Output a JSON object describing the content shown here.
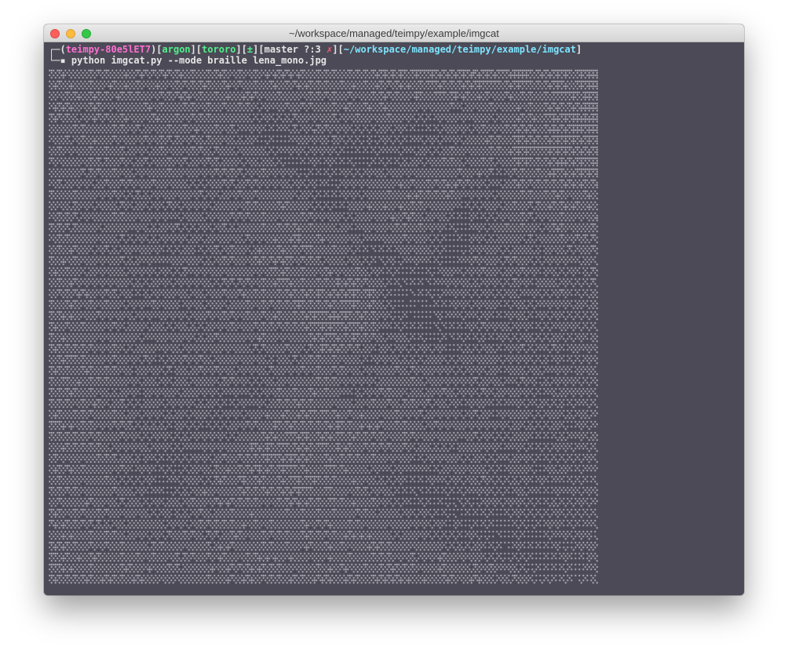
{
  "window": {
    "title": "~/workspace/managed/teimpy/example/imgcat"
  },
  "prompt": {
    "line1_prefix": "┌─(",
    "host": "teimpy-80e5lET7",
    "host_close": ")[",
    "user": "argon",
    "user_close": "][",
    "group": "tororo",
    "group_close": "][",
    "vcs_symbol": "±",
    "vcs_close": "][",
    "branch": "master ?:3 ",
    "branch_mark": "✗",
    "branch_close": "][",
    "path": "~/workspace/managed/teimpy/example/imgcat",
    "path_close": "]",
    "line2_prefix": "└─▪ ",
    "command": "python imgcat.py --mode braille lena_mono.jpg"
  },
  "colors": {
    "terminal_bg": "#4b4a56",
    "dots": "#e8e4ec",
    "host": "#ff6fd3",
    "user": "#52f08a",
    "group": "#52f08a",
    "branch_mark": "#ff5f7a",
    "path": "#7fe4ff"
  },
  "braille_art": {
    "source_file": "lena_mono.jpg",
    "mode": "braille",
    "columns": 140,
    "rows": 47
  }
}
